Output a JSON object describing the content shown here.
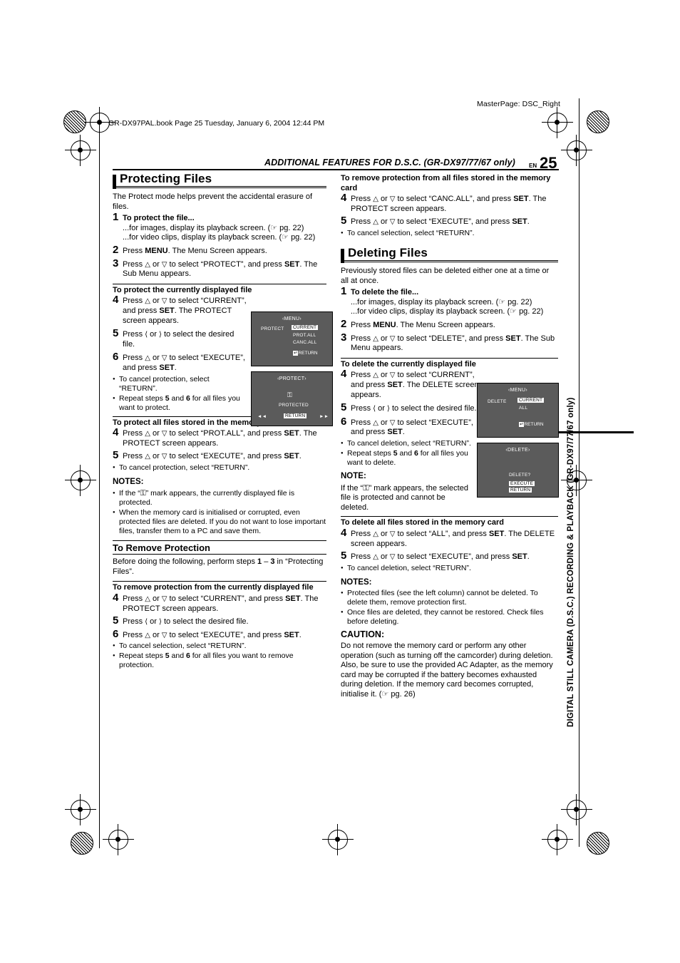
{
  "header": {
    "masterpage": "MasterPage: DSC_Right",
    "bookline": "GR-DX97PAL.book  Page 25  Tuesday, January 6, 2004  12:44 PM",
    "running_head": "ADDITIONAL FEATURES FOR D.S.C. (GR-DX97/77/67 only)",
    "en_label": "EN",
    "page_number": "25"
  },
  "side_tab": {
    "text": "DIGITAL STILL CAMERA (D.S.C.) RECORDING & PLAYBACK (GR-DX97/77/67 only)"
  },
  "left": {
    "section_title": "Protecting Files",
    "intro": "The Protect mode helps prevent the accidental erasure of files.",
    "step1": {
      "num": "1",
      "title": "To protect the file...",
      "line1": "...for images, display its playback screen. (☞ pg. 22)",
      "line2": "...for video clips, display its playback screen. (☞ pg. 22)"
    },
    "step2": {
      "num": "2",
      "text_pre": "Press ",
      "bold1": "MENU",
      "text_post": ". The Menu Screen appears."
    },
    "step3": {
      "num": "3",
      "a": "Press ",
      "b": " or ",
      "c": " to select “PROTECT”, and press ",
      "d": "SET",
      "e": ". The Sub Menu appears."
    },
    "sub1": "To protect the currently displayed file",
    "step4a": {
      "num": "4",
      "a": "Press ",
      "b": " or ",
      "c": " to select “CURRENT”, and press ",
      "d": "SET",
      "e": ". The PROTECT screen appears."
    },
    "step5a": {
      "num": "5",
      "a": "Press ",
      "b": " or ",
      "c": " to select the desired file."
    },
    "step6a": {
      "num": "6",
      "a": "Press ",
      "b": " or ",
      "c": " to select “EXECUTE”, and press ",
      "d": "SET",
      "e": "."
    },
    "b6a1": "To cancel protection, select “RETURN”.",
    "b6a2_pre": "Repeat steps ",
    "b6a2_n1": "5",
    "b6a2_mid": " and ",
    "b6a2_n2": "6",
    "b6a2_post": " for all files you want to protect.",
    "sub2": "To protect all files stored in the memory card",
    "step4b": {
      "num": "4",
      "a": "Press ",
      "b": " or ",
      "c": " to select “PROT.ALL”, and press ",
      "d": "SET",
      "e": ". The PROTECT screen appears."
    },
    "step5b": {
      "num": "5",
      "a": "Press ",
      "b": " or ",
      "c": " to select “EXECUTE”, and press ",
      "d": "SET",
      "e": "."
    },
    "b5b": "To cancel protection, select “RETURN”.",
    "notes_title": "NOTES:",
    "note1_pre": "If the “",
    "note1_icon": "⚿",
    "note1_post": "” mark appears, the currently displayed file is protected.",
    "note2": "When the memory card is initialised or corrupted, even protected files are deleted. If you do not want to lose important files, transfer them to a PC and save them.",
    "sub_remove_title": "To Remove Protection",
    "remove_intro_a": "Before doing the following, perform steps ",
    "remove_n1": "1",
    "remove_dash": " – ",
    "remove_n2": "3",
    "remove_intro_b": " in “Protecting Files”.",
    "sub3": "To remove protection from the currently displayed file",
    "step4c": {
      "num": "4",
      "a": "Press ",
      "b": " or ",
      "c": " to select “CURRENT”, and press ",
      "d": "SET",
      "e": ". The PROTECT screen appears."
    },
    "step5c": {
      "num": "5",
      "a": "Press ",
      "b": " or ",
      "c": " to select the desired file."
    },
    "step6c": {
      "num": "6",
      "a": "Press ",
      "b": " or ",
      "c": " to select “EXECUTE”, and press ",
      "d": "SET",
      "e": "."
    },
    "b6c1": "To cancel selection, select “RETURN”.",
    "b6c2_pre": "Repeat steps ",
    "b6c2_n1": "5",
    "b6c2_mid": " and ",
    "b6c2_n2": "6",
    "b6c2_post": " for all files you want to remove protection."
  },
  "right": {
    "sub1": "To remove protection from all files stored in the memory card",
    "step4a": {
      "num": "4",
      "a": "Press ",
      "b": " or ",
      "c": " to select “CANC.ALL”, and press ",
      "d": "SET",
      "e": ". The PROTECT screen appears."
    },
    "step5a": {
      "num": "5",
      "a": "Press ",
      "b": " or ",
      "c": " to select “EXECUTE”, and press ",
      "d": "SET",
      "e": "."
    },
    "b5a": "To cancel selection, select “RETURN”.",
    "section_title": "Deleting Files",
    "intro": "Previously stored files can be deleted either one at a time or all at once.",
    "step1": {
      "num": "1",
      "title": "To delete the file...",
      "line1": "...for images, display its playback screen. (☞ pg. 22)",
      "line2": "...for video clips, display its playback screen. (☞ pg. 22)"
    },
    "step2": {
      "num": "2",
      "text_pre": "Press ",
      "bold1": "MENU",
      "text_post": ". The Menu Screen appears."
    },
    "step3": {
      "num": "3",
      "a": "Press ",
      "b": " or ",
      "c": " to select “DELETE”, and press ",
      "d": "SET",
      "e": ". The Sub Menu appears."
    },
    "sub2": "To delete the currently displayed file",
    "step4b": {
      "num": "4",
      "a": "Press ",
      "b": " or ",
      "c": " to select “CURRENT”, and press ",
      "d": "SET",
      "e": ". The DELETE screen appears."
    },
    "step5b": {
      "num": "5",
      "a": "Press ",
      "b": " or ",
      "c": " to select the desired file."
    },
    "step6b": {
      "num": "6",
      "a": "Press ",
      "b": " or ",
      "c": " to select “EXECUTE”, and press ",
      "d": "SET",
      "e": "."
    },
    "b6b1": "To cancel deletion, select “RETURN”.",
    "b6b2_pre": "Repeat steps ",
    "b6b2_n1": "5",
    "b6b2_mid": " and ",
    "b6b2_n2": "6",
    "b6b2_post": " for all files you want to delete.",
    "note_title": "NOTE:",
    "note_pre": "If the “",
    "note_icon": "⚿",
    "note_post": "” mark appears, the selected file is protected and cannot be deleted.",
    "sub3": "To delete all files stored in the memory card",
    "step4c": {
      "num": "4",
      "a": "Press ",
      "b": " or ",
      "c": " to select “ALL”, and press ",
      "d": "SET",
      "e": ". The DELETE screen appears."
    },
    "step5c": {
      "num": "5",
      "a": "Press ",
      "b": " or ",
      "c": " to select “EXECUTE”, and press ",
      "d": "SET",
      "e": "."
    },
    "b5c": "To cancel deletion, select “RETURN”.",
    "notes_title": "NOTES:",
    "note1": "Protected files (see the left column) cannot be deleted. To delete them, remove protection first.",
    "note2": "Once files are deleted, they cannot be restored. Check files before deleting.",
    "caution_title": "CAUTION:",
    "caution": "Do not remove the memory card or perform any other operation (such as turning off the camcorder) during deletion. Also, be sure to use the provided AC Adapter, as the memory card may be corrupted if the battery becomes exhausted during deletion. If the memory card becomes corrupted, initialise it. (☞ pg. 26)"
  },
  "lcd": {
    "protect_menu": {
      "title": "‹MENU›",
      "left_label": "PROTECT",
      "selected": "CURRENT",
      "opt2": "PROT.ALL",
      "opt3": "CANC.ALL",
      "return_key": "↵",
      "return_label": "RETURN"
    },
    "protect_screen": {
      "title": "‹PROTECT›",
      "lock": "⚿",
      "status": "PROTECTED",
      "left_arrows": "◄◄",
      "right_arrows": "►►",
      "return_label": "RETURN"
    },
    "delete_menu": {
      "title": "‹MENU›",
      "left_label": "DELETE",
      "selected": "CURRENT",
      "opt2": "ALL",
      "return_key": "↵",
      "return_label": "RETURN"
    },
    "delete_screen": {
      "title": "‹DELETE›",
      "question": "DELETE?",
      "execute": "EXECUTE",
      "return_label": "RETURN"
    }
  }
}
